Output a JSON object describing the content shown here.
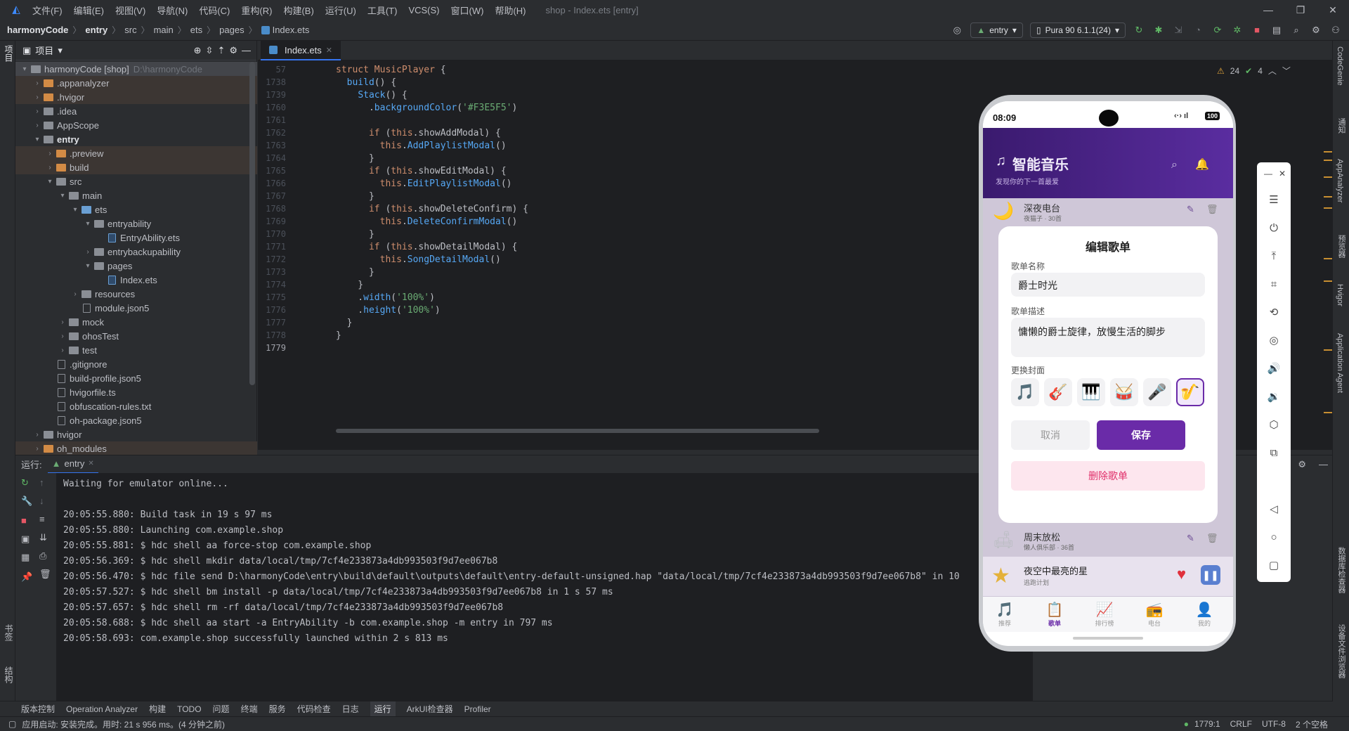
{
  "menubar": {
    "items": [
      "文件(F)",
      "编辑(E)",
      "视图(V)",
      "导航(N)",
      "代码(C)",
      "重构(R)",
      "构建(B)",
      "运行(U)",
      "工具(T)",
      "VCS(S)",
      "窗口(W)",
      "帮助(H)"
    ],
    "window_title": "shop - Index.ets [entry]"
  },
  "breadcrumb": [
    "harmonyCode",
    "entry",
    "src",
    "main",
    "ets",
    "pages",
    "Index.ets"
  ],
  "toolbar": {
    "module": "entry",
    "device": "Pura 90 6.1.1(24)"
  },
  "project": {
    "header": "项目",
    "tree": [
      {
        "label": "harmonyCode [shop]",
        "path": "D:\\harmonyCode",
        "depth": 0,
        "open": true,
        "kind": "folder",
        "selected": true
      },
      {
        "label": ".appanalyzer",
        "depth": 1,
        "open": false,
        "kind": "folder-orange",
        "excluded": true
      },
      {
        "label": ".hvigor",
        "depth": 1,
        "open": false,
        "kind": "folder-orange",
        "excluded": true
      },
      {
        "label": ".idea",
        "depth": 1,
        "open": false,
        "kind": "folder"
      },
      {
        "label": "AppScope",
        "depth": 1,
        "open": false,
        "kind": "folder"
      },
      {
        "label": "entry",
        "depth": 1,
        "open": true,
        "kind": "folder",
        "bold": true
      },
      {
        "label": ".preview",
        "depth": 2,
        "open": false,
        "kind": "folder-orange",
        "excluded": true
      },
      {
        "label": "build",
        "depth": 2,
        "open": false,
        "kind": "folder-orange",
        "excluded": true
      },
      {
        "label": "src",
        "depth": 2,
        "open": true,
        "kind": "folder"
      },
      {
        "label": "main",
        "depth": 3,
        "open": true,
        "kind": "folder"
      },
      {
        "label": "ets",
        "depth": 4,
        "open": true,
        "kind": "folder-blue"
      },
      {
        "label": "entryability",
        "depth": 5,
        "open": true,
        "kind": "folder"
      },
      {
        "label": "EntryAbility.ets",
        "depth": 6,
        "kind": "file-ets"
      },
      {
        "label": "entrybackupability",
        "depth": 5,
        "open": false,
        "kind": "folder"
      },
      {
        "label": "pages",
        "depth": 5,
        "open": true,
        "kind": "folder"
      },
      {
        "label": "Index.ets",
        "depth": 6,
        "kind": "file-ets"
      },
      {
        "label": "resources",
        "depth": 4,
        "open": false,
        "kind": "folder"
      },
      {
        "label": "module.json5",
        "depth": 4,
        "kind": "file"
      },
      {
        "label": "mock",
        "depth": 3,
        "open": false,
        "kind": "folder"
      },
      {
        "label": "ohosTest",
        "depth": 3,
        "open": false,
        "kind": "folder"
      },
      {
        "label": "test",
        "depth": 3,
        "open": false,
        "kind": "folder"
      },
      {
        "label": ".gitignore",
        "depth": 2,
        "kind": "file"
      },
      {
        "label": "build-profile.json5",
        "depth": 2,
        "kind": "file"
      },
      {
        "label": "hvigorfile.ts",
        "depth": 2,
        "kind": "file"
      },
      {
        "label": "obfuscation-rules.txt",
        "depth": 2,
        "kind": "file"
      },
      {
        "label": "oh-package.json5",
        "depth": 2,
        "kind": "file"
      },
      {
        "label": "hvigor",
        "depth": 1,
        "open": false,
        "kind": "folder"
      },
      {
        "label": "oh_modules",
        "depth": 1,
        "open": false,
        "kind": "folder-orange",
        "excluded": true
      }
    ]
  },
  "editor": {
    "tab": "Index.ets",
    "warnings": "24",
    "weak_warnings": "4",
    "lines": [
      {
        "n": "57",
        "segs": [
          [
            "kw",
            "struct "
          ],
          [
            "th",
            "MusicPlayer "
          ],
          [
            "plain",
            "{"
          ]
        ]
      },
      {
        "n": "1738",
        "segs": [
          [
            "plain",
            "  "
          ],
          [
            "fn",
            "build"
          ],
          [
            "plain",
            "() {"
          ]
        ]
      },
      {
        "n": "1739",
        "segs": [
          [
            "plain",
            "    "
          ],
          [
            "fn",
            "Stack"
          ],
          [
            "plain",
            "() {"
          ]
        ]
      },
      {
        "n": "1760",
        "segs": [
          [
            "plain",
            "      ."
          ],
          [
            "fn",
            "backgroundColor"
          ],
          [
            "plain",
            "("
          ],
          [
            "str",
            "'#F3E5F5'"
          ],
          [
            "plain",
            ")"
          ]
        ]
      },
      {
        "n": "1761",
        "segs": []
      },
      {
        "n": "1762",
        "segs": [
          [
            "plain",
            "      "
          ],
          [
            "kw",
            "if "
          ],
          [
            "plain",
            "("
          ],
          [
            "kw",
            "this"
          ],
          [
            "plain",
            ".showAddModal) {"
          ]
        ]
      },
      {
        "n": "1763",
        "segs": [
          [
            "plain",
            "        "
          ],
          [
            "kw",
            "this"
          ],
          [
            "plain",
            "."
          ],
          [
            "fn",
            "AddPlaylistModal"
          ],
          [
            "plain",
            "()"
          ]
        ]
      },
      {
        "n": "1764",
        "segs": [
          [
            "plain",
            "      }"
          ]
        ]
      },
      {
        "n": "1765",
        "segs": [
          [
            "plain",
            "      "
          ],
          [
            "kw",
            "if "
          ],
          [
            "plain",
            "("
          ],
          [
            "kw",
            "this"
          ],
          [
            "plain",
            ".showEditModal) {"
          ]
        ]
      },
      {
        "n": "1766",
        "segs": [
          [
            "plain",
            "        "
          ],
          [
            "kw",
            "this"
          ],
          [
            "plain",
            "."
          ],
          [
            "fn",
            "EditPlaylistModal"
          ],
          [
            "plain",
            "()"
          ]
        ]
      },
      {
        "n": "1767",
        "segs": [
          [
            "plain",
            "      }"
          ]
        ]
      },
      {
        "n": "1768",
        "segs": [
          [
            "plain",
            "      "
          ],
          [
            "kw",
            "if "
          ],
          [
            "plain",
            "("
          ],
          [
            "kw",
            "this"
          ],
          [
            "plain",
            ".showDeleteConfirm) {"
          ]
        ]
      },
      {
        "n": "1769",
        "segs": [
          [
            "plain",
            "        "
          ],
          [
            "kw",
            "this"
          ],
          [
            "plain",
            "."
          ],
          [
            "fn",
            "DeleteConfirmModal"
          ],
          [
            "plain",
            "()"
          ]
        ]
      },
      {
        "n": "1770",
        "segs": [
          [
            "plain",
            "      }"
          ]
        ]
      },
      {
        "n": "1771",
        "segs": [
          [
            "plain",
            "      "
          ],
          [
            "kw",
            "if "
          ],
          [
            "plain",
            "("
          ],
          [
            "kw",
            "this"
          ],
          [
            "plain",
            ".showDetailModal) {"
          ]
        ]
      },
      {
        "n": "1772",
        "segs": [
          [
            "plain",
            "        "
          ],
          [
            "kw",
            "this"
          ],
          [
            "plain",
            "."
          ],
          [
            "fn",
            "SongDetailModal"
          ],
          [
            "plain",
            "()"
          ]
        ]
      },
      {
        "n": "1773",
        "segs": [
          [
            "plain",
            "      }"
          ]
        ]
      },
      {
        "n": "1774",
        "segs": [
          [
            "plain",
            "    }"
          ]
        ]
      },
      {
        "n": "1775",
        "segs": [
          [
            "plain",
            "    ."
          ],
          [
            "fn",
            "width"
          ],
          [
            "plain",
            "("
          ],
          [
            "str",
            "'100%'"
          ],
          [
            "plain",
            ")"
          ]
        ]
      },
      {
        "n": "1776",
        "segs": [
          [
            "plain",
            "    ."
          ],
          [
            "fn",
            "height"
          ],
          [
            "plain",
            "("
          ],
          [
            "str",
            "'100%'"
          ],
          [
            "plain",
            ")"
          ]
        ]
      },
      {
        "n": "1777",
        "segs": [
          [
            "plain",
            "  }"
          ]
        ]
      },
      {
        "n": "1778",
        "segs": [
          [
            "plain",
            "}"
          ]
        ]
      },
      {
        "n": "1779",
        "segs": []
      }
    ]
  },
  "run": {
    "label": "运行:",
    "tab": "entry",
    "console": [
      "Waiting for emulator online...",
      "",
      "20:05:55.880: Build task in 19 s 97 ms",
      "20:05:55.880: Launching com.example.shop",
      "20:05:55.881: $ hdc shell aa force-stop com.example.shop",
      "20:05:56.369: $ hdc shell mkdir data/local/tmp/7cf4e233873a4db993503f9d7ee067b8",
      "20:05:56.470: $ hdc file send D:\\harmonyCode\\entry\\build\\default\\outputs\\default\\entry-default-unsigned.hap \"data/local/tmp/7cf4e233873a4db993503f9d7ee067b8\" in 10",
      "20:05:57.527: $ hdc shell bm install -p data/local/tmp/7cf4e233873a4db993503f9d7ee067b8 in 1 s 57 ms",
      "20:05:57.657: $ hdc shell rm -rf data/local/tmp/7cf4e233873a4db993503f9d7ee067b8",
      "20:05:58.688: $ hdc shell aa start -a EntryAbility -b com.example.shop -m entry in 797 ms",
      "20:05:58.693: com.example.shop successfully launched within 2 s 813 ms"
    ]
  },
  "bottom_tools": [
    "版本控制",
    "Operation Analyzer",
    "构建",
    "TODO",
    "问题",
    "终端",
    "服务",
    "代码检查",
    "日志",
    "运行",
    "ArkUI检查器",
    "Profiler"
  ],
  "status": {
    "message": "应用启动: 安装完成。用时: 21 s 956 ms。(4 分钟之前)",
    "position": "1779:1",
    "line_sep": "CRLF",
    "encoding": "UTF-8",
    "indent": "2 个空格"
  },
  "right_strip": [
    "CodeGenie",
    "通知",
    "AppAnalyzer",
    "预览器",
    "Hvigor",
    "Application Agent",
    "数据库检查器",
    "设备文件浏览器"
  ],
  "left_strip": [
    "项目",
    "书签",
    "结构"
  ],
  "phone": {
    "time": "08:09",
    "battery": "100",
    "app_title": "智能音乐",
    "app_subtitle": "发现你的下一首最爱",
    "bg_item_top": {
      "title": "深夜电台",
      "sub": "夜猫子 · 30首"
    },
    "bg_item_2": {
      "title": "周末放松",
      "sub": "懒人俱乐部 · 36首"
    },
    "now_playing": {
      "title": "夜空中最亮的星",
      "sub": "逃跑计划"
    },
    "dialog": {
      "title": "编辑歌单",
      "name_label": "歌单名称",
      "name_value": "爵士时光",
      "desc_label": "歌单描述",
      "desc_value": "慵懒的爵士旋律，放慢生活的脚步",
      "cover_label": "更换封面",
      "covers": [
        "🎵",
        "🎸",
        "🎹",
        "🥁",
        "🎤",
        "🎷"
      ],
      "cancel": "取消",
      "save": "保存",
      "delete": "删除歌单"
    },
    "tabs": [
      {
        "icon": "🎵",
        "label": "推荐"
      },
      {
        "icon": "📋",
        "label": "歌单"
      },
      {
        "icon": "📈",
        "label": "排行榜"
      },
      {
        "icon": "📻",
        "label": "电台"
      },
      {
        "icon": "👤",
        "label": "我的"
      }
    ],
    "accent": "#6a2ba8"
  }
}
